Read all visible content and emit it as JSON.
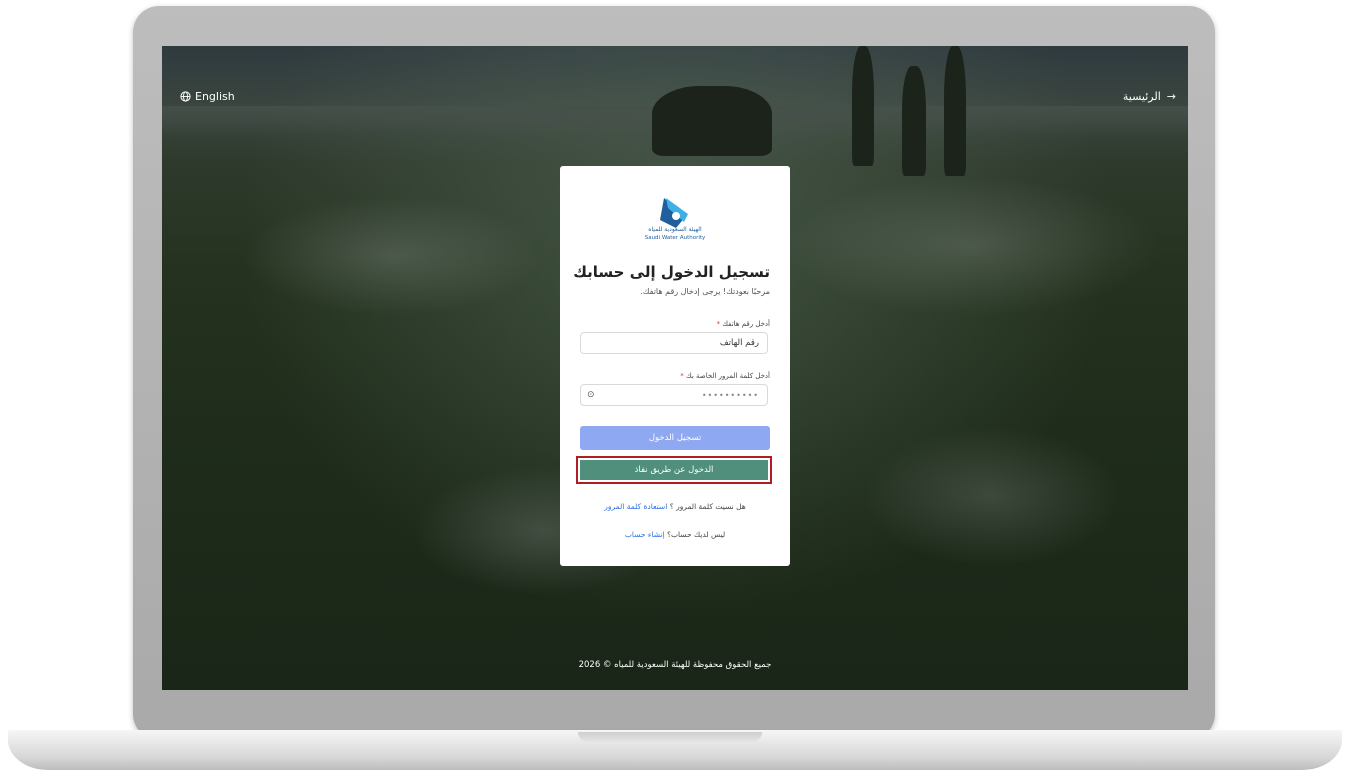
{
  "header": {
    "language_label": "English",
    "home_label": "الرئيسية"
  },
  "logo": {
    "name_ar": "الهيئة السعودية للمياه",
    "name_en": "Saudi Water Authority"
  },
  "login": {
    "title": "تسجيل الدخول إلى حسابك",
    "subtitle": "مرحبًا بعودتك! يرجى إدخال رقم هاتفك.",
    "phone_label": "أدخل رقم هاتفك",
    "phone_placeholder": "رقم الهاتف",
    "password_label": "أدخل كلمة المرور الخاصة بك",
    "password_value": "••••••••••",
    "required_mark": "*",
    "login_button": "تسجيل الدخول",
    "nafath_button": "الدخول عن طريق نفاذ",
    "forgot_text": "هل نسيت كلمة المرور ؟",
    "forgot_link": "استعادة كلمة المرور",
    "no_account_text": "ليس لديك حساب؟",
    "signup_link": "إنشاء حساب"
  },
  "footer": {
    "copyright": "جميع الحقوق محفوظة للهيئة السعودية للمياه © 2026"
  },
  "colors": {
    "primary_button": "#8fa8f2",
    "nafath_button": "#4f8f7b",
    "highlight_border": "#b01e23",
    "link": "#2f6ee6"
  }
}
